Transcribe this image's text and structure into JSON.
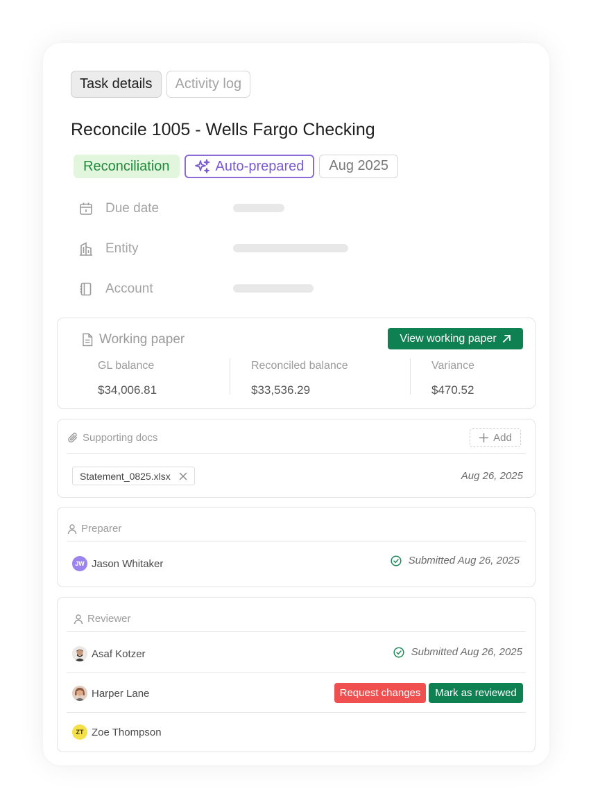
{
  "tabs": [
    {
      "label": "Task details",
      "active": true
    },
    {
      "label": "Activity log",
      "active": false
    }
  ],
  "task": {
    "title": "Reconcile 1005 - Wells Fargo Checking",
    "badges": {
      "type": "Reconciliation",
      "auto": "Auto-prepared",
      "period": "Aug 2025"
    }
  },
  "meta": {
    "due_date": "Due date",
    "entity": "Entity",
    "account": "Account"
  },
  "working_paper": {
    "title": "Working paper",
    "button": "View working paper",
    "stats": [
      {
        "label": "GL balance",
        "value": "$34,006.81"
      },
      {
        "label": "Reconciled balance",
        "value": "$33,536.29"
      },
      {
        "label": "Variance",
        "value": "$470.52"
      }
    ]
  },
  "supporting_docs": {
    "title": "Supporting docs",
    "add_label": "Add",
    "file": {
      "name": "Statement_0825.xlsx",
      "date": "Aug 26, 2025"
    }
  },
  "preparer": {
    "title": "Preparer",
    "person": {
      "initials": "JW",
      "name": "Jason Whitaker",
      "status": "Submitted Aug 26, 2025"
    }
  },
  "reviewer": {
    "title": "Reviewer",
    "people": [
      {
        "name": "Asaf Kotzer",
        "status": "Submitted Aug 26, 2025"
      },
      {
        "name": "Harper Lane",
        "request_label": "Request changes",
        "review_label": "Mark as reviewed"
      },
      {
        "initials": "ZT",
        "name": "Zoe Thompson"
      }
    ]
  },
  "colors": {
    "accent_green": "#0f8052",
    "danger_red": "#f04f4f",
    "badge_green_bg": "#e2f6dd",
    "badge_purple": "#7a5bcf",
    "avatar_jw": "#9b84ee",
    "avatar_zt": "#f6e04a"
  }
}
